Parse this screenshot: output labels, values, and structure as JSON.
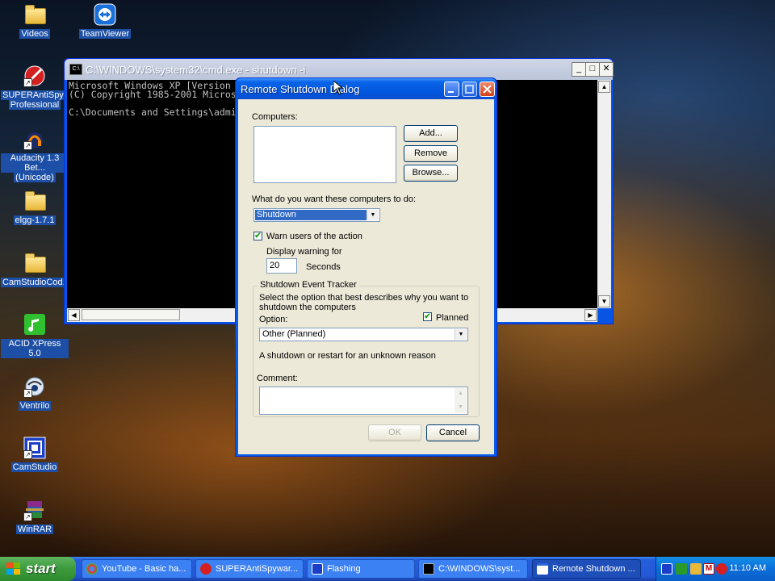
{
  "desktop": {
    "icons": [
      {
        "label": "Videos",
        "icon": "folder-icon"
      },
      {
        "label": "TeamViewer",
        "icon": "teamviewer-icon"
      },
      {
        "label": "SUPERAntiSpy...\nProfessional",
        "line1": "SUPERAntiSpy...",
        "line2": "Professional",
        "icon": "superantispyware-icon"
      },
      {
        "line1": "Audacity 1.3 Bet...",
        "line2": "(Unicode)",
        "icon": "audacity-icon"
      },
      {
        "label": "elgg-1.7.1",
        "icon": "folder-icon"
      },
      {
        "label": "CamStudioCod...",
        "icon": "folder-icon"
      },
      {
        "label": "ACID XPress 5.0",
        "icon": "acid-icon"
      },
      {
        "label": "Ventrilo",
        "icon": "ventrilo-icon"
      },
      {
        "label": "CamStudio",
        "icon": "camstudio-icon"
      },
      {
        "label": "WinRAR",
        "icon": "winrar-icon"
      }
    ]
  },
  "cmd_window": {
    "title": "C:\\WINDOWS\\system32\\cmd.exe - shutdown -i",
    "line1": "Microsoft Windows XP [Version 5.",
    "line2": "(C) Copyright 1985-2001 Microsof",
    "line3": "",
    "line4": "C:\\Documents and Settings\\admin",
    "minimize": "_",
    "maximize": "□",
    "close": "✕"
  },
  "dialog": {
    "title": "Remote Shutdown Dialog",
    "computers_label": "Computers:",
    "add_button": "Add...",
    "remove_button": "Remove",
    "browse_button": "Browse...",
    "action_question": "What do you want these computers to do:",
    "action_value": "Shutdown",
    "warn_checkbox_label": "Warn users of the action",
    "warn_checked": "✔",
    "display_warning_label": "Display warning for",
    "seconds_value": "20",
    "seconds_label": "Seconds",
    "tracker_group_title": "Shutdown Event Tracker",
    "tracker_description_1": "Select the option that best describes why you want to",
    "tracker_description_2": "shutdown the computers",
    "option_label": "Option:",
    "planned_label": "Planned",
    "planned_checked": "✔",
    "option_value": "Other (Planned)",
    "reason_text": "A shutdown or restart for an unknown reason",
    "comment_label": "Comment:",
    "ok_button": "OK",
    "cancel_button": "Cancel"
  },
  "taskbar": {
    "start_label": "start",
    "buttons": [
      {
        "label": "YouTube - Basic ha...",
        "icon": "chrome-icon"
      },
      {
        "label": "SUPERAntiSpywar...",
        "icon": "superantispyware-icon"
      },
      {
        "label": "Flashing",
        "icon": "camstudio-icon"
      },
      {
        "label": "C:\\WINDOWS\\syst...",
        "icon": "cmd-icon"
      },
      {
        "label": "Remote Shutdown ...",
        "icon": "window-icon"
      }
    ],
    "clock": "11:10 AM"
  },
  "colors": {
    "xp_blue": "#0a5ae8",
    "dialog_face": "#ece9d8",
    "start_green": "#3c9a3c",
    "selection_blue": "#316ac5"
  }
}
